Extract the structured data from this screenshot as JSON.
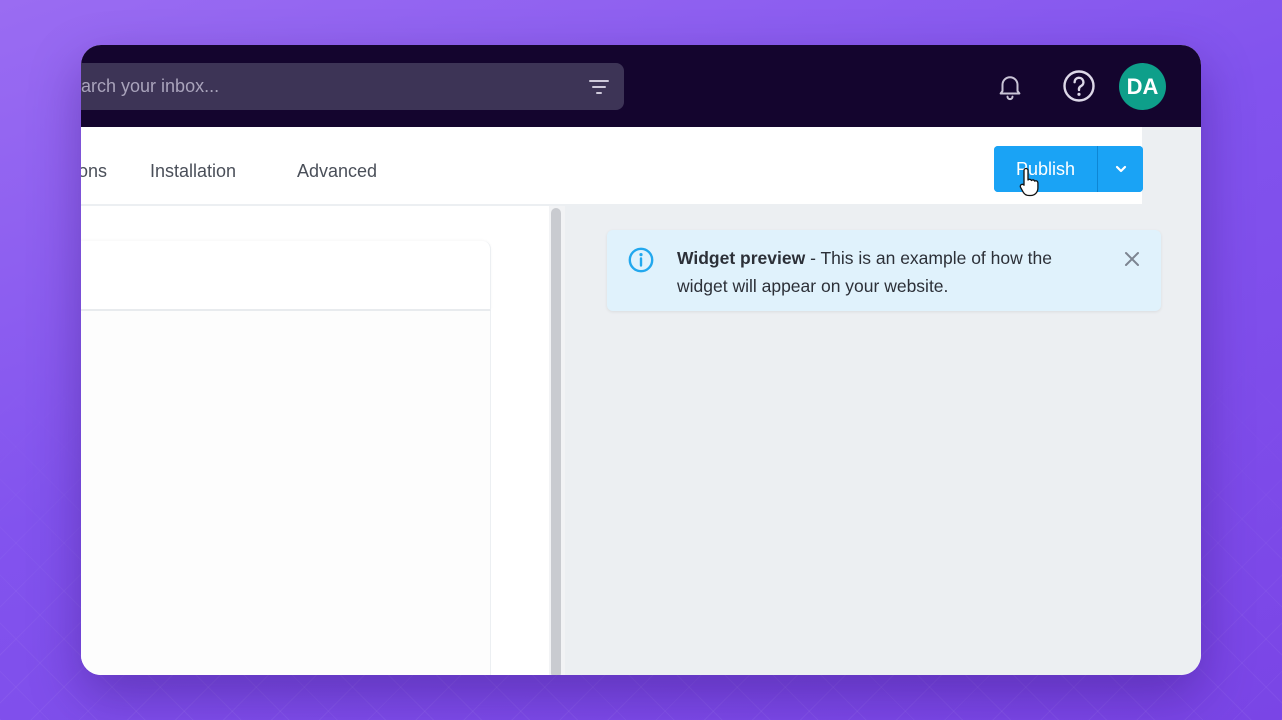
{
  "header": {
    "search": {
      "placeholder": "Search your inbox...",
      "value": ""
    },
    "avatar_initials": "DA",
    "icons": [
      "filter-icon",
      "bell-icon",
      "help-icon"
    ]
  },
  "tabs": [
    {
      "label": "ons",
      "partial": true
    },
    {
      "label": "Installation"
    },
    {
      "label": "Advanced"
    }
  ],
  "publish": {
    "label": "Publish",
    "dropdown_icon": "chevron-down-icon"
  },
  "banner": {
    "title": "Widget preview",
    "text": " - This is an example of how the widget will appear on your website.",
    "icon": "info-icon",
    "close_icon": "close-icon"
  },
  "colors": {
    "header_bg": "#14052e",
    "accent": "#1aa3f5",
    "avatar": "#0e9f8a",
    "banner_bg": "#e0f2fc",
    "preview_bg": "#eceff2",
    "background": "#8253ee"
  }
}
